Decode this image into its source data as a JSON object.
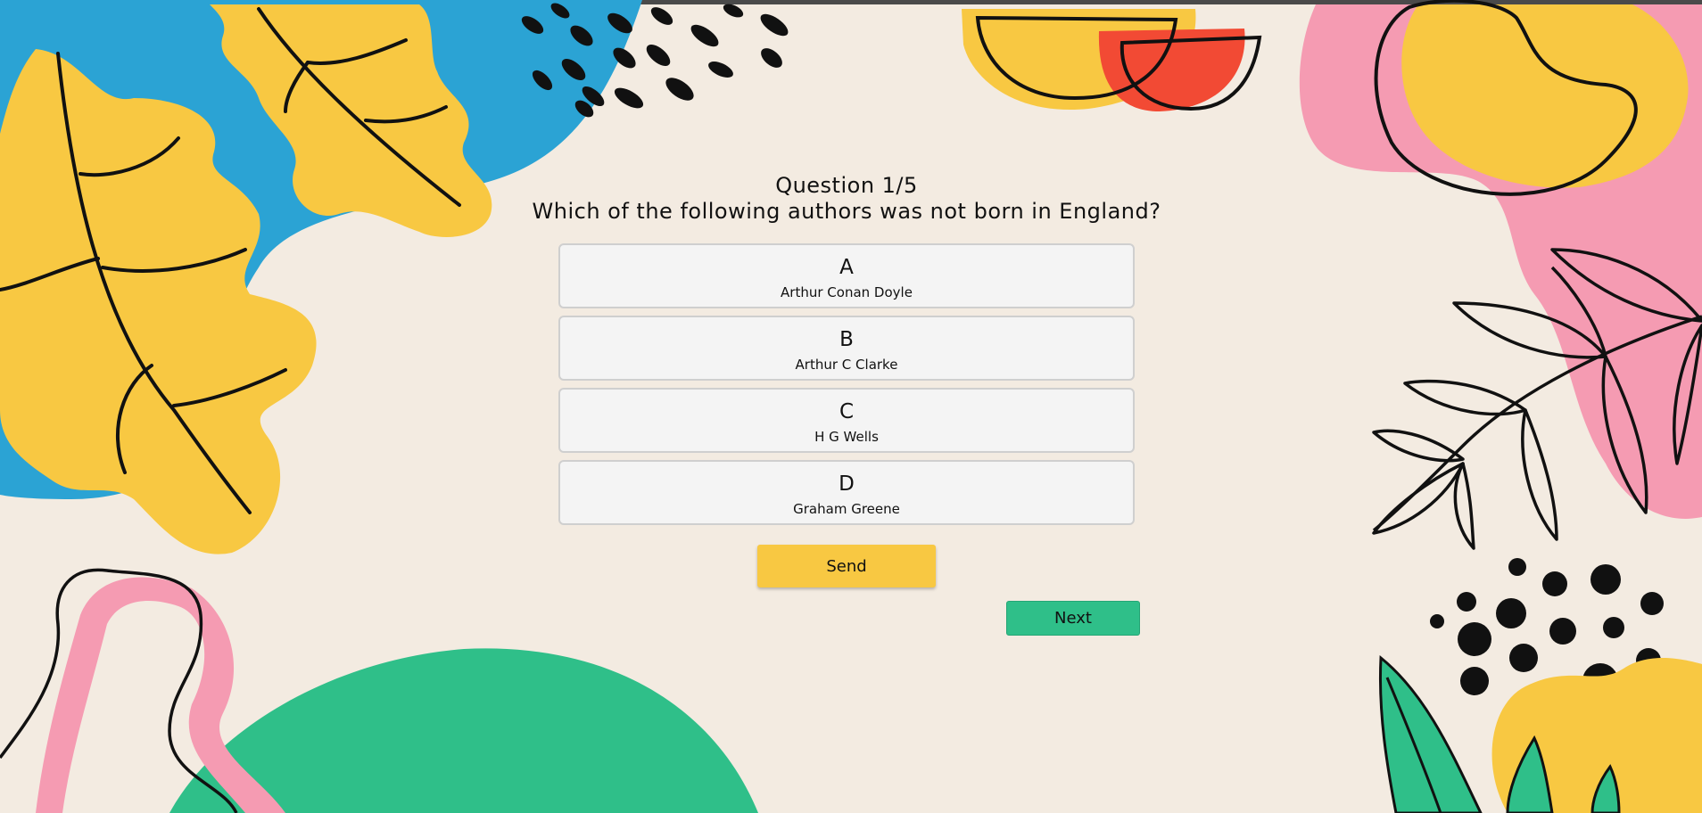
{
  "quiz": {
    "question_number": "Question 1/5",
    "question_text": "Which of the following authors was not born in England?",
    "options": [
      {
        "letter": "A",
        "text": "Arthur Conan Doyle"
      },
      {
        "letter": "B",
        "text": "Arthur C Clarke"
      },
      {
        "letter": "C",
        "text": "H G Wells"
      },
      {
        "letter": "D",
        "text": "Graham Greene"
      }
    ],
    "send_label": "Send",
    "next_label": "Next"
  },
  "colors": {
    "background": "#f3ebe1",
    "yellow": "#f8c842",
    "blue": "#2ba3d4",
    "pink": "#f59bb2",
    "red": "#f24a34",
    "green": "#2fbf89",
    "ink": "#111111"
  }
}
